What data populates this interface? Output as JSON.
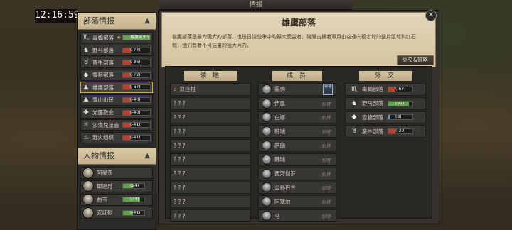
{
  "clock": "12:16:59",
  "window_title": "情报",
  "tribe_section": {
    "title": "部落情报"
  },
  "tribes": [
    {
      "name": "毒蝎部落",
      "star": "★",
      "relation": "极度友好(100)",
      "fill": 1.0,
      "color": "#5fa34a",
      "icon": "scorpion-icon",
      "glyph": "♏"
    },
    {
      "name": "野马部落",
      "star": "",
      "relation": "(-74)",
      "fill": 0.3,
      "color": "#b8402f",
      "icon": "horse-icon",
      "glyph": "♞"
    },
    {
      "name": "蛮牛部落",
      "star": "",
      "relation": "(-36)",
      "fill": 0.3,
      "color": "#b8402f",
      "icon": "bull-icon",
      "glyph": "♉"
    },
    {
      "name": "雪狼部落",
      "star": "",
      "relation": "(-72)",
      "fill": 0.3,
      "color": "#b8402f",
      "icon": "wolf-icon",
      "glyph": "◆"
    },
    {
      "name": "雄鹰部落",
      "star": "",
      "relation": "(-67)",
      "fill": 0.3,
      "color": "#b8402f",
      "icon": "eagle-icon",
      "glyph": "▲",
      "selected": true
    },
    {
      "name": "雪山山民",
      "star": "",
      "relation": "(-40)",
      "fill": 0.3,
      "color": "#b8402f",
      "icon": "mountain-icon",
      "glyph": "⛰"
    },
    {
      "name": "光疆教会",
      "star": "",
      "relation": "(-40)",
      "fill": 0.3,
      "color": "#b8402f",
      "icon": "church-icon",
      "glyph": "✚"
    },
    {
      "name": "沙漠兄弟会",
      "star": "",
      "relation": "(-41)",
      "fill": 0.3,
      "color": "#b8402f",
      "icon": "sand-icon",
      "glyph": "☼"
    },
    {
      "name": "野火组织",
      "star": "",
      "relation": "(-41)",
      "fill": 0.3,
      "color": "#b8402f",
      "icon": "fire-icon",
      "glyph": "♨"
    }
  ],
  "people_section": {
    "title": "人物情报"
  },
  "people": [
    {
      "name": "阿曼莎",
      "relation": "",
      "fill": 0,
      "color": "#5fa34a"
    },
    {
      "name": "耶迟月",
      "relation": "(24)",
      "fill": 0.45,
      "color": "#5fa34a"
    },
    {
      "name": "曲玉",
      "relation": "(74)",
      "fill": 0.8,
      "color": "#5fa34a"
    },
    {
      "name": "安红砂",
      "relation": "(-41)",
      "fill": 0.45,
      "color": "#5fa34a"
    }
  ],
  "selected_tribe": {
    "title": "雄鹰部落",
    "description": "雄鹰部落是最为强大的部落，也是日饶战争中的最大受益者。雄鹰占据着双月山谷通向德宏城的整片区域和红石城，他们有着不可估量的强大兵力。",
    "strategy_button": "外交&策略"
  },
  "columns": {
    "territory": {
      "title": "领 地"
    },
    "members": {
      "title": "成 员"
    },
    "diplomacy": {
      "title": "外 交"
    }
  },
  "territory": [
    {
      "name": "双桂村",
      "known": true
    },
    {
      "name": "? ? ?"
    },
    {
      "name": "? ? ?"
    },
    {
      "name": "? ? ?"
    },
    {
      "name": "? ? ?"
    },
    {
      "name": "? ? ?"
    },
    {
      "name": "? ? ?"
    },
    {
      "name": "? ? ?"
    },
    {
      "name": "? ? ?"
    },
    {
      "name": "? ? ?"
    }
  ],
  "members": [
    {
      "name": "霍驹",
      "tag": "",
      "leader": true,
      "badge": "领袖"
    },
    {
      "name": "伊凰",
      "tag": "斜坏"
    },
    {
      "name": "白娜",
      "tag": "斜坏"
    },
    {
      "name": "韩瑞",
      "tag": "斜坏"
    },
    {
      "name": "萨珈",
      "tag": "斜坏"
    },
    {
      "name": "韩瑞",
      "tag": "斜坏"
    },
    {
      "name": "西河伽罗",
      "tag": "斜坏"
    },
    {
      "name": "公孙巴兰",
      "tag": "斜坏"
    },
    {
      "name": "阿塞尔",
      "tag": "斜坏"
    },
    {
      "name": "马",
      "tag": "斜坏"
    }
  ],
  "diplomacy": [
    {
      "name": "毒蝎部落",
      "relation": "(-67)",
      "fill": 0.3,
      "color": "#b8402f",
      "icon": "scorpion-icon",
      "glyph": "♏"
    },
    {
      "name": "野马部落",
      "relation": "(91)",
      "fill": 0.85,
      "color": "#5fa34a",
      "icon": "horse-icon",
      "glyph": "♞"
    },
    {
      "name": "雪狼部落",
      "relation": "(8)",
      "fill": 0.05,
      "color": "#4aa3d4",
      "icon": "wolf-icon",
      "glyph": "◆"
    },
    {
      "name": "蛮牛部落",
      "relation": "(-30)",
      "fill": 0.3,
      "color": "#b8402f",
      "icon": "bull-icon",
      "glyph": "♉"
    }
  ]
}
